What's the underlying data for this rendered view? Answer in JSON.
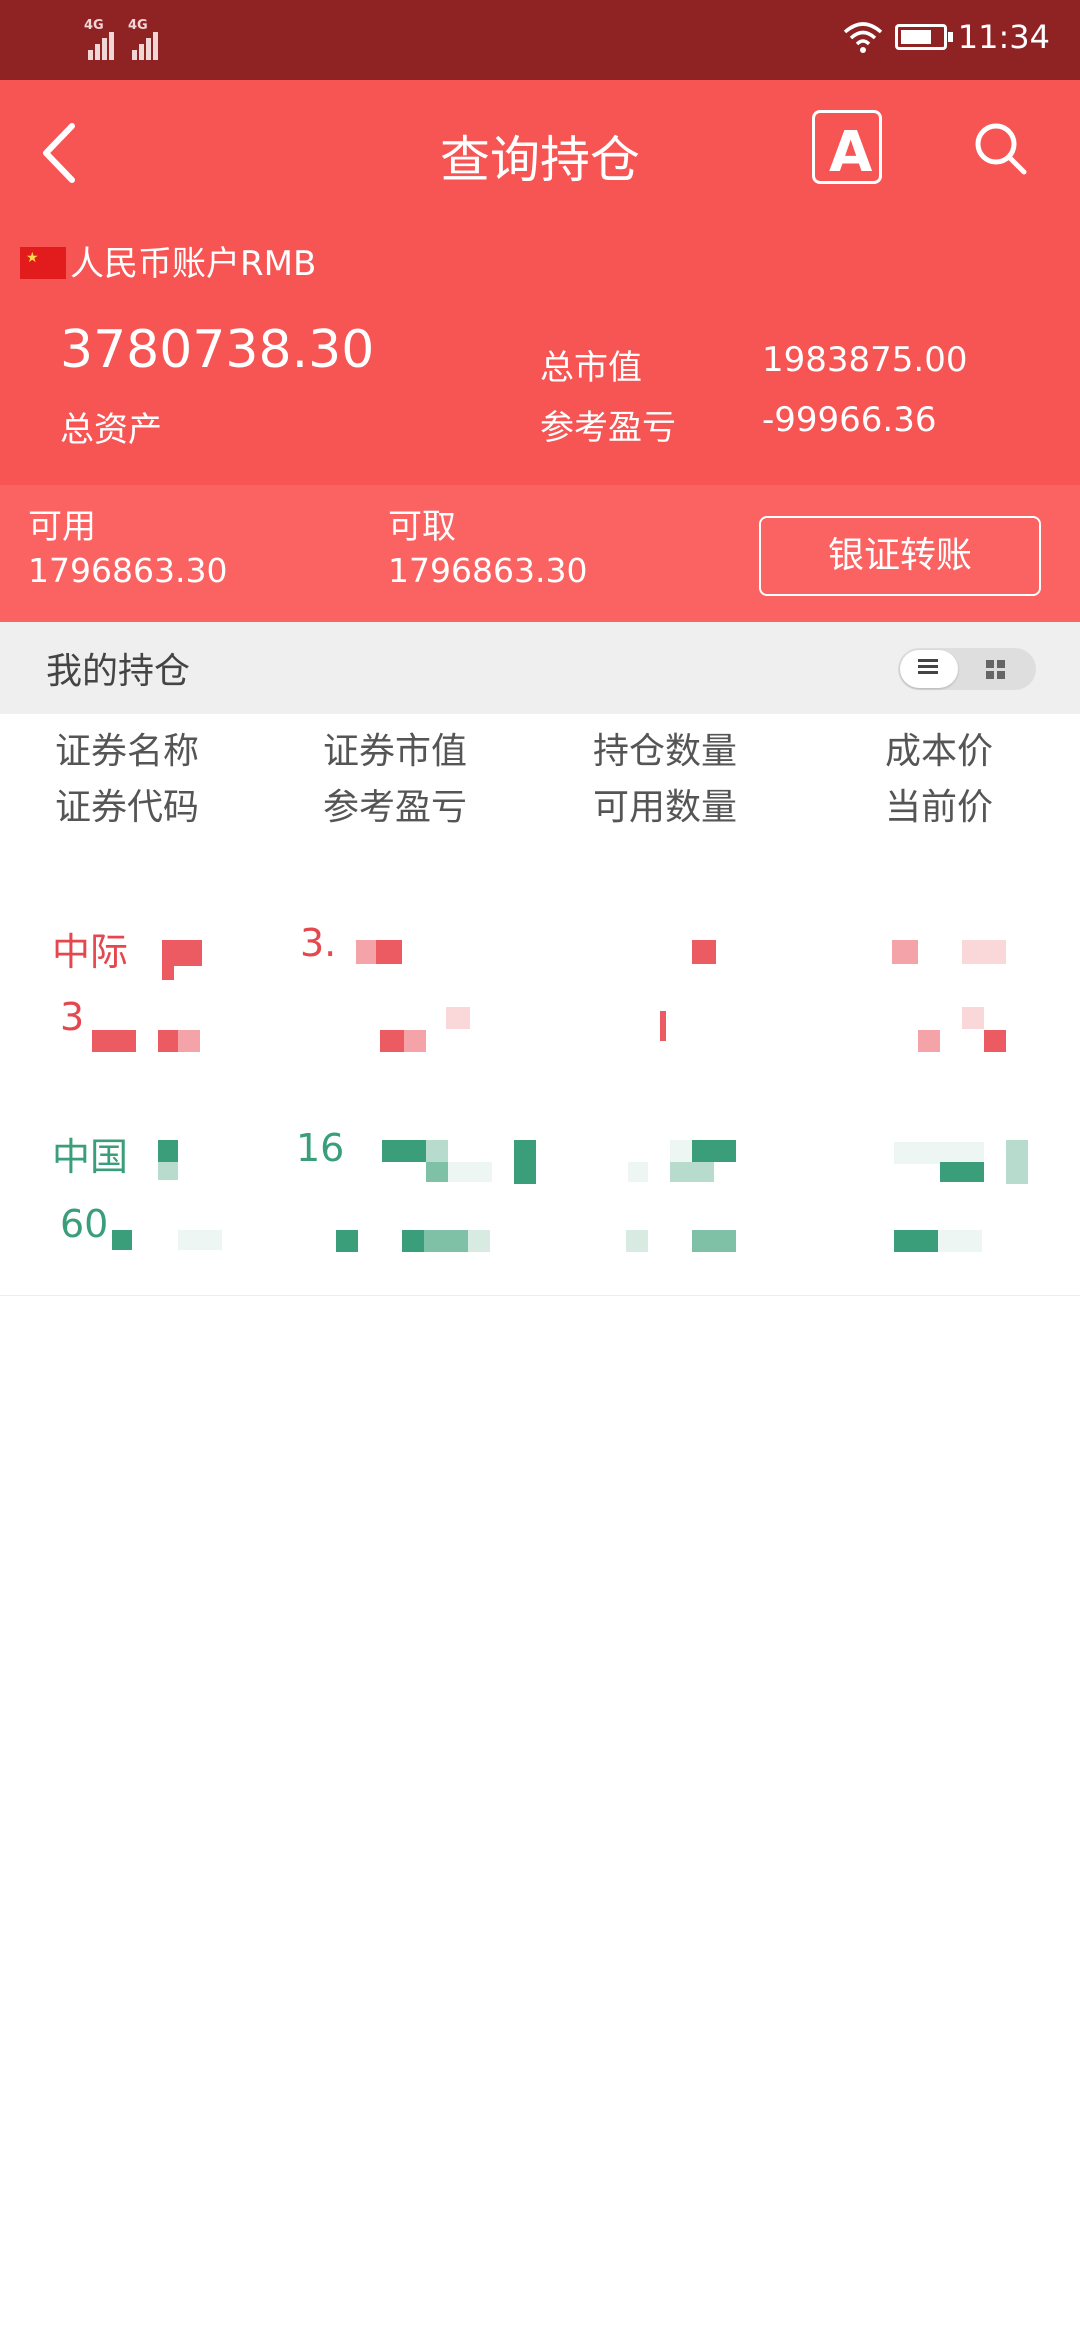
{
  "status_bar": {
    "net1": "4G",
    "net2": "4G",
    "time": "11:34"
  },
  "header": {
    "title": "查询持仓",
    "font_button_glyph": "A",
    "account_label": "人民币账户RMB",
    "total_assets_value": "3780738.30",
    "total_assets_label": "总资产",
    "market_value_label": "总市值",
    "market_value": "1983875.00",
    "ref_pl_label": "参考盈亏",
    "ref_pl_value": "-99966.36"
  },
  "balance": {
    "available_label": "可用",
    "available_value": "1796863.30",
    "withdrawable_label": "可取",
    "withdrawable_value": "1796863.30",
    "transfer_button": "银证转账"
  },
  "holdings": {
    "title": "我的持仓",
    "columns": [
      {
        "top": "证券名称",
        "bottom": "证券代码"
      },
      {
        "top": "证券市值",
        "bottom": "参考盈亏"
      },
      {
        "top": "持仓数量",
        "bottom": "可用数量"
      },
      {
        "top": "成本价",
        "bottom": "当前价"
      }
    ],
    "rows": [
      {
        "name": "中际",
        "code": "3",
        "market_value": "3.",
        "color": "red"
      },
      {
        "name": "中国",
        "code": "60",
        "market_value": "16",
        "color": "green"
      }
    ]
  },
  "colors": {
    "header": "#f75454",
    "status": "#8f2323",
    "gain": "#e5474f",
    "loss": "#3a9e7b"
  }
}
